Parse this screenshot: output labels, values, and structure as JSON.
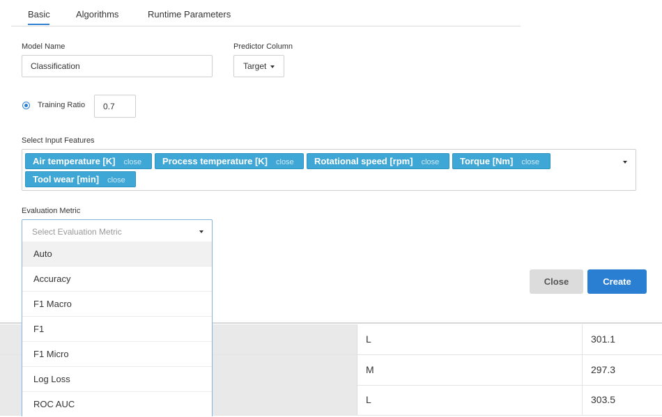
{
  "tabs": [
    {
      "label": "Basic"
    },
    {
      "label": "Algorithms"
    },
    {
      "label": "Runtime Parameters"
    }
  ],
  "form": {
    "model_name_label": "Model Name",
    "model_name_value": "Classification",
    "predictor_label": "Predictor Column",
    "predictor_value": "Target",
    "training_ratio_label": "Training Ratio",
    "training_ratio_value": "0.7",
    "input_features_label": "Select Input Features",
    "input_features": [
      {
        "label": "Air temperature [K]",
        "close_glyph": "",
        "close_text": "close"
      },
      {
        "label": "Process temperature [K]",
        "close_glyph": "",
        "close_text": "close"
      },
      {
        "label": "Rotational speed [rpm]",
        "close_glyph": "",
        "close_text": "close"
      },
      {
        "label": "Torque [Nm]",
        "close_glyph": "",
        "close_text": "close"
      },
      {
        "label": "Tool wear [min]",
        "close_glyph": "",
        "close_text": "close"
      }
    ],
    "metric_label": "Evaluation Metric",
    "metric_placeholder": "Select Evaluation Metric",
    "metric_options": [
      "Auto",
      "Accuracy",
      "F1 Macro",
      "F1",
      "F1 Micro",
      "Log Loss",
      "ROC AUC"
    ]
  },
  "buttons": {
    "close": "Close",
    "create": "Create"
  },
  "background_table": {
    "rows": [
      {
        "type": "L",
        "value": "301.1"
      },
      {
        "type": "M",
        "value": "297.3"
      },
      {
        "type": "L",
        "value": "303.5"
      }
    ]
  },
  "colors": {
    "accent": "#2b7fd2",
    "tag": "#3fa7d6"
  }
}
